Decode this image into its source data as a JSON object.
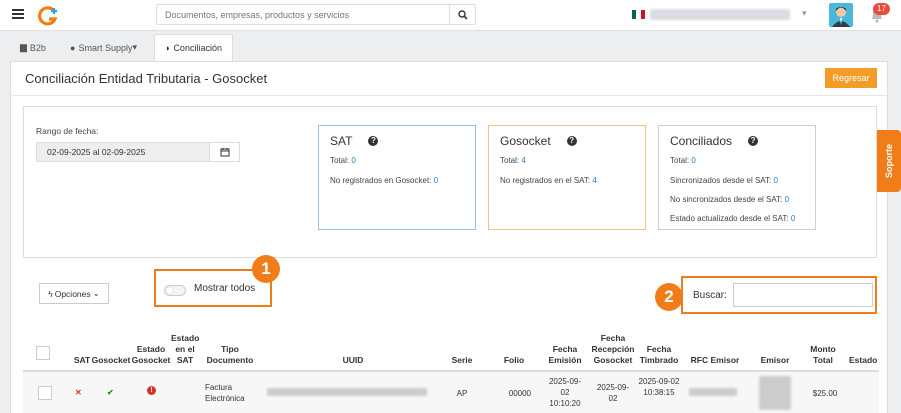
{
  "header": {
    "search_placeholder": "Documentos, empresas, productos y servicios",
    "notifications_count": "17",
    "flag_colors": [
      "#006847",
      "#ffffff",
      "#ce1126"
    ]
  },
  "tabs": [
    {
      "label": "B2b",
      "icon": "file-icon"
    },
    {
      "label": "Smart Supply",
      "icon": "globe-icon",
      "caret": "▾"
    },
    {
      "label": "Conciliación",
      "icon": "shield-icon",
      "active": true
    }
  ],
  "page": {
    "title": "Conciliación Entidad Tributaria - Gosocket",
    "back_button": "Regresar"
  },
  "filters": {
    "date_label": "Rango de fecha:",
    "date_value": "02-09-2025 al 02-09-2025"
  },
  "cards": {
    "sat": {
      "title": "SAT",
      "total_label": "Total:",
      "total": "0",
      "missing_label": "No registrados en Gosocket:",
      "missing": "0"
    },
    "gosocket": {
      "title": "Gosocket",
      "total_label": "Total:",
      "total": "4",
      "missing_label": "No registrados en el SAT:",
      "missing": "4"
    },
    "conciliados": {
      "title": "Conciliados",
      "total_label": "Total:",
      "total": "0",
      "sync_label": "Sincronizados desde el SAT:",
      "sync": "0",
      "nosync_label": "No sincronizados desde el SAT:",
      "nosync": "0",
      "updated_label": "Estado actualizado desde el SAT:",
      "updated": "0"
    }
  },
  "toolbar": {
    "options_label": "Opciones",
    "show_all_label": "Mostrar todos",
    "search_label": "Buscar:",
    "callout_1": "1",
    "callout_2": "2"
  },
  "support_tab": "Soporte",
  "table": {
    "headers": {
      "sat": "SAT",
      "gosocket": "Gosocket",
      "estado_gosocket": "Estado Gosocket",
      "estado_sat": "Estado en el SAT",
      "tipo": "Tipo Documento",
      "uuid": "UUID",
      "serie": "Serie",
      "folio": "Folio",
      "fecha_emision": "Fecha Emisión",
      "fecha_recepcion": "Fecha Recepción Gosocket",
      "fecha_timbrado": "Fecha Timbrado",
      "rfc_emisor": "RFC Emisor",
      "emisor": "Emisor",
      "monto": "Monto Total",
      "estado_sinc": "Estado Sincroniz"
    },
    "rows": [
      {
        "sat_mark": "✕",
        "gosocket_mark": "✔",
        "estado_gosocket_mark": "!",
        "tipo": "Factura Electrónica",
        "serie": "AP",
        "folio": "00000",
        "fecha_emision": "2025-09-02 10:10:20",
        "fecha_recepcion": "2025-09-02",
        "fecha_timbrado": "2025-09-02 10:38:15",
        "monto": "$25.00"
      }
    ]
  }
}
